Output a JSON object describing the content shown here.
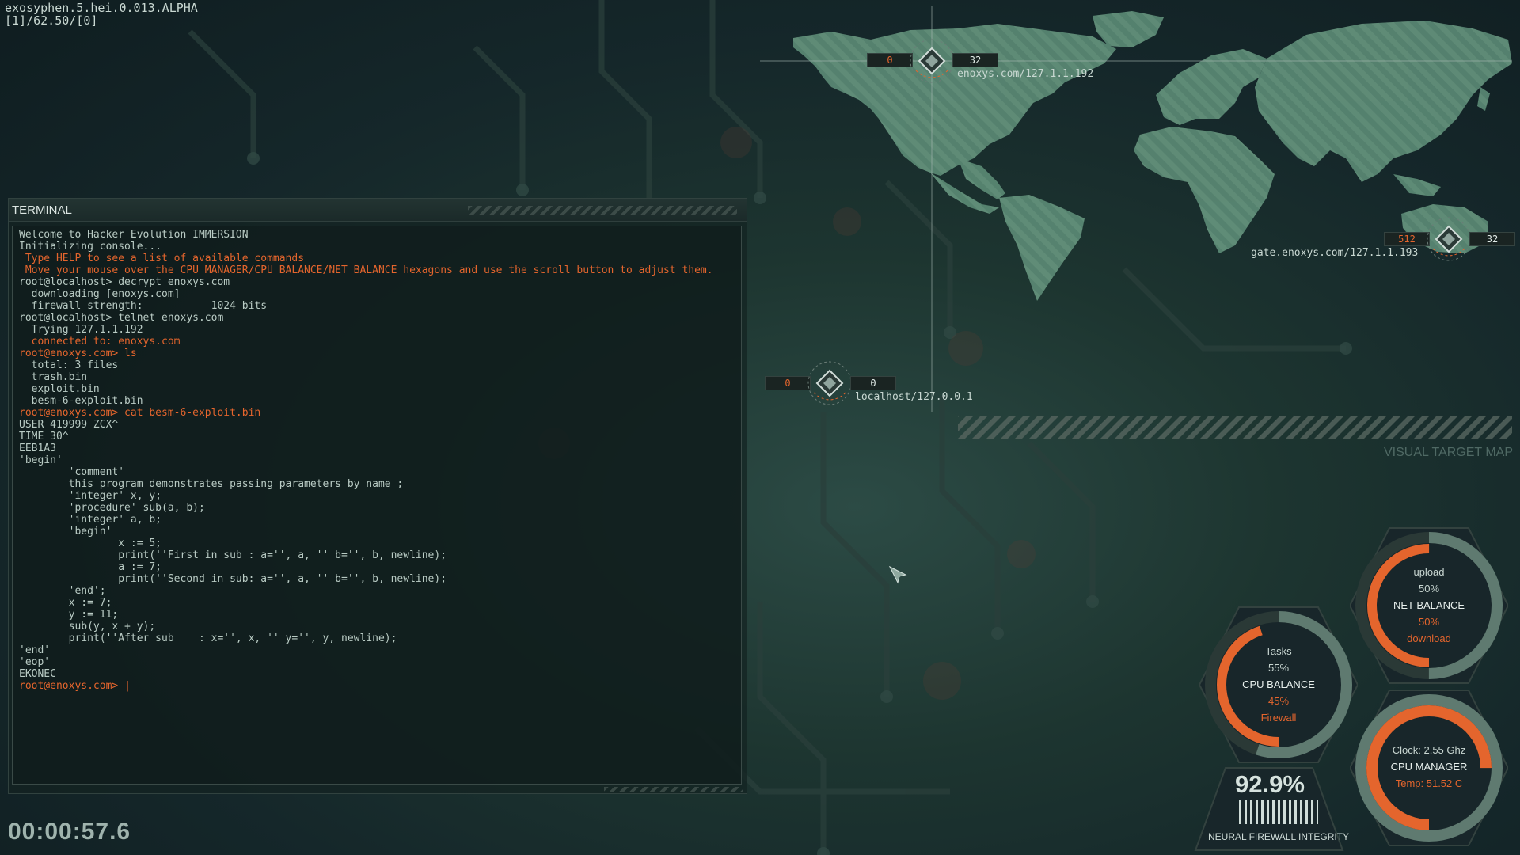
{
  "version": {
    "line1": "exosyphen.5.hei.0.013.ALPHA",
    "line2": "[1]/62.50/[0]"
  },
  "terminal": {
    "title": "TERMINAL",
    "lines": [
      {
        "text": "Welcome to Hacker Evolution IMMERSION",
        "color": "normal"
      },
      {
        "text": "Initializing console...",
        "color": "normal"
      },
      {
        "text": " Type HELP to see a list of available commands",
        "color": "orange"
      },
      {
        "text": " Move your mouse over the CPU MANAGER/CPU BALANCE/NET BALANCE hexagons and use the scroll button to adjust them.",
        "color": "orange"
      },
      {
        "text": "root@localhost> decrypt enoxys.com",
        "color": "normal"
      },
      {
        "text": "  downloading [enoxys.com]",
        "color": "normal"
      },
      {
        "text": "  firewall strength:           1024 bits",
        "color": "normal"
      },
      {
        "text": "root@localhost> telnet enoxys.com",
        "color": "normal"
      },
      {
        "text": "  Trying 127.1.1.192",
        "color": "normal"
      },
      {
        "text": "  connected to: enoxys.com",
        "color": "orange"
      },
      {
        "text": "root@enoxys.com> ls",
        "color": "orange"
      },
      {
        "text": "  total: 3 files",
        "color": "normal"
      },
      {
        "text": "  trash.bin",
        "color": "normal"
      },
      {
        "text": "  exploit.bin",
        "color": "normal"
      },
      {
        "text": "  besm-6-exploit.bin",
        "color": "normal"
      },
      {
        "text": "root@enoxys.com> cat besm-6-exploit.bin",
        "color": "orange"
      },
      {
        "text": "USER 419999 ZCX^",
        "color": "normal"
      },
      {
        "text": "TIME 30^",
        "color": "normal"
      },
      {
        "text": "EEB1A3",
        "color": "normal"
      },
      {
        "text": "'begin'",
        "color": "normal"
      },
      {
        "text": "        'comment'",
        "color": "normal"
      },
      {
        "text": "        this program demonstrates passing parameters by name ;",
        "color": "normal"
      },
      {
        "text": "        'integer' x, y;",
        "color": "normal"
      },
      {
        "text": "        'procedure' sub(a, b);",
        "color": "normal"
      },
      {
        "text": "        'integer' a, b;",
        "color": "normal"
      },
      {
        "text": "        'begin'",
        "color": "normal"
      },
      {
        "text": "                x := 5;",
        "color": "normal"
      },
      {
        "text": "                print(''First in sub : a='', a, '' b='', b, newline);",
        "color": "normal"
      },
      {
        "text": "                a := 7;",
        "color": "normal"
      },
      {
        "text": "                print(''Second in sub: a='', a, '' b='', b, newline);",
        "color": "normal"
      },
      {
        "text": "",
        "color": "normal"
      },
      {
        "text": "        'end';",
        "color": "normal"
      },
      {
        "text": "        x := 7;",
        "color": "normal"
      },
      {
        "text": "        y := 11;",
        "color": "normal"
      },
      {
        "text": "        sub(y, x + y);",
        "color": "normal"
      },
      {
        "text": "        print(''After sub    : x='', x, '' y='', y, newline);",
        "color": "normal"
      },
      {
        "text": "'end'",
        "color": "normal"
      },
      {
        "text": "'eop'",
        "color": "normal"
      },
      {
        "text": "EKONEC",
        "color": "normal"
      },
      {
        "text": "",
        "color": "normal"
      }
    ],
    "prompt": "root@enoxys.com> ",
    "cursor": "|"
  },
  "timer": "00:00:57.6",
  "map": {
    "caption": "VISUAL TARGET MAP",
    "nodes": [
      {
        "id": "enoxys",
        "label": "enoxys.com/127.1.1.192",
        "left_value": "0",
        "right_value": "32"
      },
      {
        "id": "gate",
        "label": "gate.enoxys.com/127.1.1.193",
        "left_value": "512",
        "right_value": "32"
      },
      {
        "id": "localhost",
        "label": "localhost/127.0.0.1",
        "left_value": "0",
        "right_value": "0"
      }
    ]
  },
  "net_balance": {
    "title": "NET BALANCE",
    "top_label": "upload",
    "top_value": "50%",
    "bottom_value": "50%",
    "bottom_label": "download",
    "upload_fraction": 0.5
  },
  "cpu_balance": {
    "title": "CPU BALANCE",
    "top_label": "Tasks",
    "top_value": "55%",
    "bottom_value": "45%",
    "bottom_label": "Firewall",
    "tasks_fraction": 0.55
  },
  "cpu_manager": {
    "title": "CPU MANAGER",
    "clock": "Clock: 2.55 Ghz",
    "temp": "Temp: 51.52 C",
    "load_fraction": 0.75
  },
  "neural_firewall": {
    "value": "92.9%",
    "label": "NEURAL FIREWALL INTEGRITY",
    "fraction": 0.929
  },
  "colors": {
    "accent_orange": "#e4652d",
    "land": "#5f8f78",
    "text": "#b9cbc4"
  }
}
